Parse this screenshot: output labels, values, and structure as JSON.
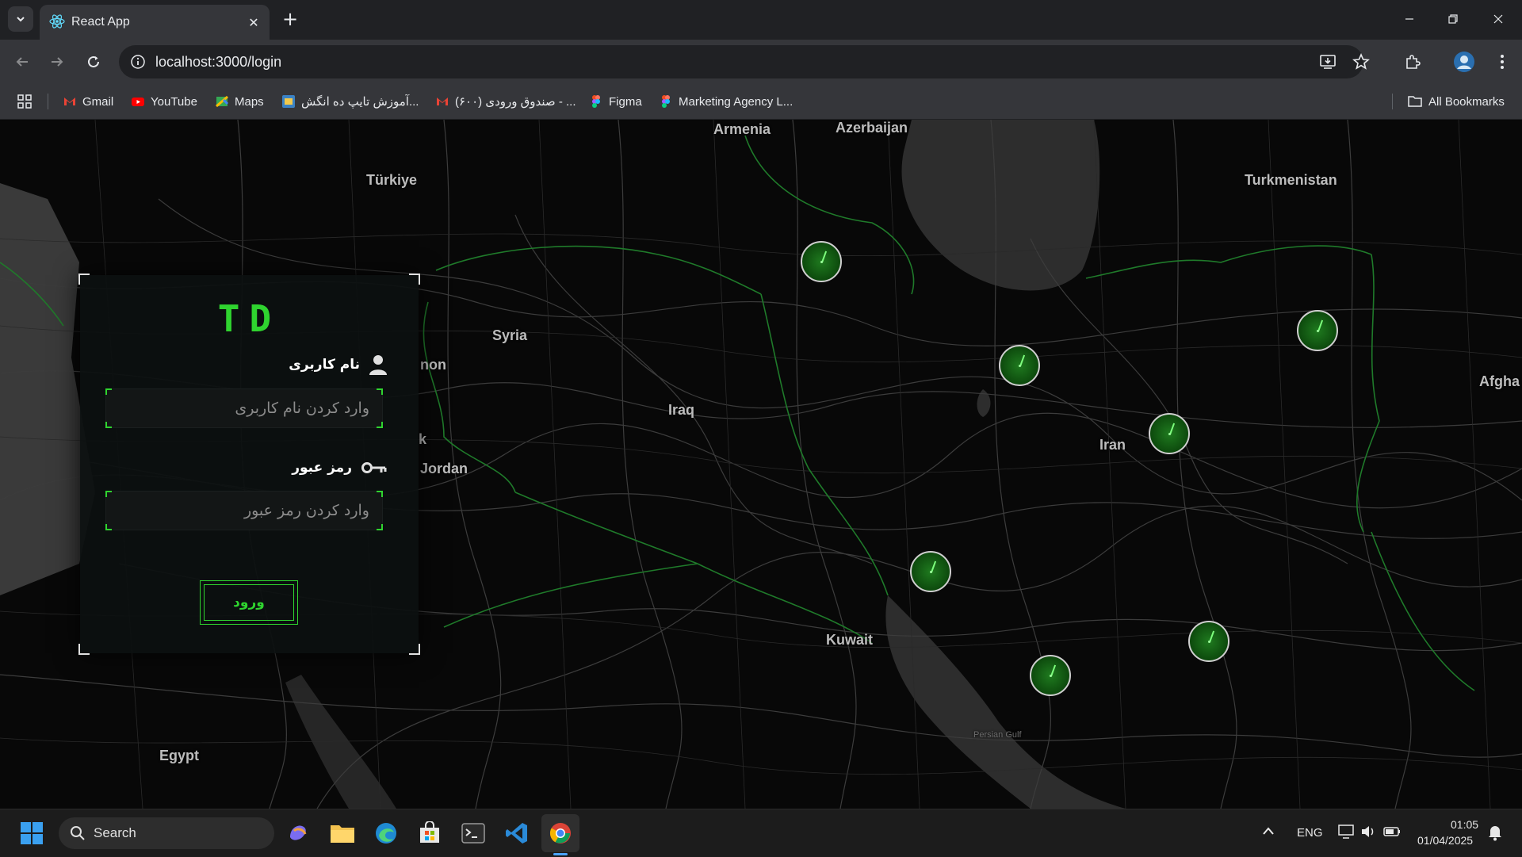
{
  "browser": {
    "tab_title": "React App",
    "url": "localhost:3000/login",
    "bookmarks": [
      {
        "label": "Gmail",
        "icon": "gmail-icon"
      },
      {
        "label": "YouTube",
        "icon": "youtube-icon"
      },
      {
        "label": "Maps",
        "icon": "maps-icon"
      },
      {
        "label": "آموزش تایپ ده انگش...",
        "icon": "typing-site-icon"
      },
      {
        "label": "صندوق ورودی (۶۰۰) - ...",
        "icon": "gmail-icon"
      },
      {
        "label": "Figma",
        "icon": "figma-icon"
      },
      {
        "label": "Marketing Agency L...",
        "icon": "figma-icon"
      }
    ],
    "all_bookmarks": "All Bookmarks"
  },
  "map": {
    "labels": [
      "Armenia",
      "Azerbaijan",
      "Türkiye",
      "Turkmenistan",
      "Syria",
      "non",
      "Iraq",
      "Iran",
      "Afgha",
      "Jordan",
      "k",
      "Kuwait",
      "Egypt",
      "Persian Gulf"
    ],
    "radar_markers": 7
  },
  "login": {
    "logo": "TD",
    "username_label": "نام کاربری",
    "username_placeholder": "وارد کردن نام کاربری",
    "password_label": "رمز عبور",
    "password_placeholder": "وارد کردن رمز عبور",
    "submit_label": "ورود",
    "accent_color": "#2fd42f"
  },
  "taskbar": {
    "search_placeholder": "Search",
    "language": "ENG",
    "time": "01:05",
    "date": "01/04/2025"
  }
}
